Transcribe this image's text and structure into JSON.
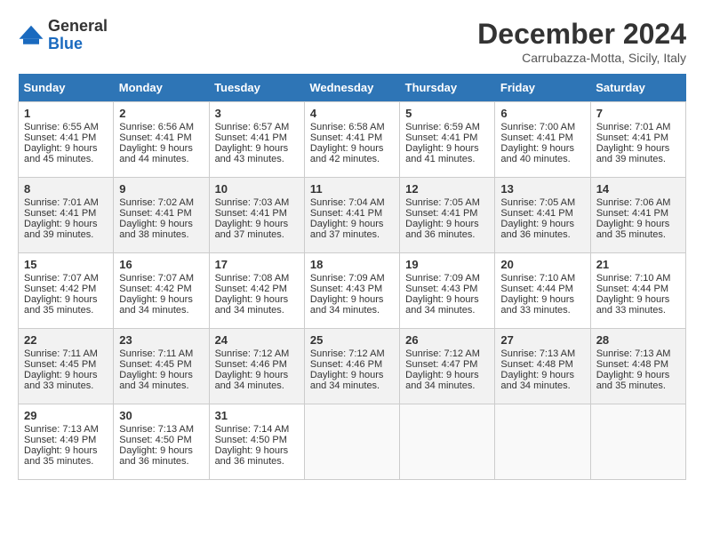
{
  "header": {
    "logo_general": "General",
    "logo_blue": "Blue",
    "month_title": "December 2024",
    "location": "Carrubazza-Motta, Sicily, Italy"
  },
  "days_of_week": [
    "Sunday",
    "Monday",
    "Tuesday",
    "Wednesday",
    "Thursday",
    "Friday",
    "Saturday"
  ],
  "weeks": [
    [
      {
        "day": "1",
        "sunrise": "Sunrise: 6:55 AM",
        "sunset": "Sunset: 4:41 PM",
        "daylight": "Daylight: 9 hours and 45 minutes."
      },
      {
        "day": "2",
        "sunrise": "Sunrise: 6:56 AM",
        "sunset": "Sunset: 4:41 PM",
        "daylight": "Daylight: 9 hours and 44 minutes."
      },
      {
        "day": "3",
        "sunrise": "Sunrise: 6:57 AM",
        "sunset": "Sunset: 4:41 PM",
        "daylight": "Daylight: 9 hours and 43 minutes."
      },
      {
        "day": "4",
        "sunrise": "Sunrise: 6:58 AM",
        "sunset": "Sunset: 4:41 PM",
        "daylight": "Daylight: 9 hours and 42 minutes."
      },
      {
        "day": "5",
        "sunrise": "Sunrise: 6:59 AM",
        "sunset": "Sunset: 4:41 PM",
        "daylight": "Daylight: 9 hours and 41 minutes."
      },
      {
        "day": "6",
        "sunrise": "Sunrise: 7:00 AM",
        "sunset": "Sunset: 4:41 PM",
        "daylight": "Daylight: 9 hours and 40 minutes."
      },
      {
        "day": "7",
        "sunrise": "Sunrise: 7:01 AM",
        "sunset": "Sunset: 4:41 PM",
        "daylight": "Daylight: 9 hours and 39 minutes."
      }
    ],
    [
      {
        "day": "8",
        "sunrise": "Sunrise: 7:01 AM",
        "sunset": "Sunset: 4:41 PM",
        "daylight": "Daylight: 9 hours and 39 minutes."
      },
      {
        "day": "9",
        "sunrise": "Sunrise: 7:02 AM",
        "sunset": "Sunset: 4:41 PM",
        "daylight": "Daylight: 9 hours and 38 minutes."
      },
      {
        "day": "10",
        "sunrise": "Sunrise: 7:03 AM",
        "sunset": "Sunset: 4:41 PM",
        "daylight": "Daylight: 9 hours and 37 minutes."
      },
      {
        "day": "11",
        "sunrise": "Sunrise: 7:04 AM",
        "sunset": "Sunset: 4:41 PM",
        "daylight": "Daylight: 9 hours and 37 minutes."
      },
      {
        "day": "12",
        "sunrise": "Sunrise: 7:05 AM",
        "sunset": "Sunset: 4:41 PM",
        "daylight": "Daylight: 9 hours and 36 minutes."
      },
      {
        "day": "13",
        "sunrise": "Sunrise: 7:05 AM",
        "sunset": "Sunset: 4:41 PM",
        "daylight": "Daylight: 9 hours and 36 minutes."
      },
      {
        "day": "14",
        "sunrise": "Sunrise: 7:06 AM",
        "sunset": "Sunset: 4:41 PM",
        "daylight": "Daylight: 9 hours and 35 minutes."
      }
    ],
    [
      {
        "day": "15",
        "sunrise": "Sunrise: 7:07 AM",
        "sunset": "Sunset: 4:42 PM",
        "daylight": "Daylight: 9 hours and 35 minutes."
      },
      {
        "day": "16",
        "sunrise": "Sunrise: 7:07 AM",
        "sunset": "Sunset: 4:42 PM",
        "daylight": "Daylight: 9 hours and 34 minutes."
      },
      {
        "day": "17",
        "sunrise": "Sunrise: 7:08 AM",
        "sunset": "Sunset: 4:42 PM",
        "daylight": "Daylight: 9 hours and 34 minutes."
      },
      {
        "day": "18",
        "sunrise": "Sunrise: 7:09 AM",
        "sunset": "Sunset: 4:43 PM",
        "daylight": "Daylight: 9 hours and 34 minutes."
      },
      {
        "day": "19",
        "sunrise": "Sunrise: 7:09 AM",
        "sunset": "Sunset: 4:43 PM",
        "daylight": "Daylight: 9 hours and 34 minutes."
      },
      {
        "day": "20",
        "sunrise": "Sunrise: 7:10 AM",
        "sunset": "Sunset: 4:44 PM",
        "daylight": "Daylight: 9 hours and 33 minutes."
      },
      {
        "day": "21",
        "sunrise": "Sunrise: 7:10 AM",
        "sunset": "Sunset: 4:44 PM",
        "daylight": "Daylight: 9 hours and 33 minutes."
      }
    ],
    [
      {
        "day": "22",
        "sunrise": "Sunrise: 7:11 AM",
        "sunset": "Sunset: 4:45 PM",
        "daylight": "Daylight: 9 hours and 33 minutes."
      },
      {
        "day": "23",
        "sunrise": "Sunrise: 7:11 AM",
        "sunset": "Sunset: 4:45 PM",
        "daylight": "Daylight: 9 hours and 34 minutes."
      },
      {
        "day": "24",
        "sunrise": "Sunrise: 7:12 AM",
        "sunset": "Sunset: 4:46 PM",
        "daylight": "Daylight: 9 hours and 34 minutes."
      },
      {
        "day": "25",
        "sunrise": "Sunrise: 7:12 AM",
        "sunset": "Sunset: 4:46 PM",
        "daylight": "Daylight: 9 hours and 34 minutes."
      },
      {
        "day": "26",
        "sunrise": "Sunrise: 7:12 AM",
        "sunset": "Sunset: 4:47 PM",
        "daylight": "Daylight: 9 hours and 34 minutes."
      },
      {
        "day": "27",
        "sunrise": "Sunrise: 7:13 AM",
        "sunset": "Sunset: 4:48 PM",
        "daylight": "Daylight: 9 hours and 34 minutes."
      },
      {
        "day": "28",
        "sunrise": "Sunrise: 7:13 AM",
        "sunset": "Sunset: 4:48 PM",
        "daylight": "Daylight: 9 hours and 35 minutes."
      }
    ],
    [
      {
        "day": "29",
        "sunrise": "Sunrise: 7:13 AM",
        "sunset": "Sunset: 4:49 PM",
        "daylight": "Daylight: 9 hours and 35 minutes."
      },
      {
        "day": "30",
        "sunrise": "Sunrise: 7:13 AM",
        "sunset": "Sunset: 4:50 PM",
        "daylight": "Daylight: 9 hours and 36 minutes."
      },
      {
        "day": "31",
        "sunrise": "Sunrise: 7:14 AM",
        "sunset": "Sunset: 4:50 PM",
        "daylight": "Daylight: 9 hours and 36 minutes."
      },
      null,
      null,
      null,
      null
    ]
  ]
}
